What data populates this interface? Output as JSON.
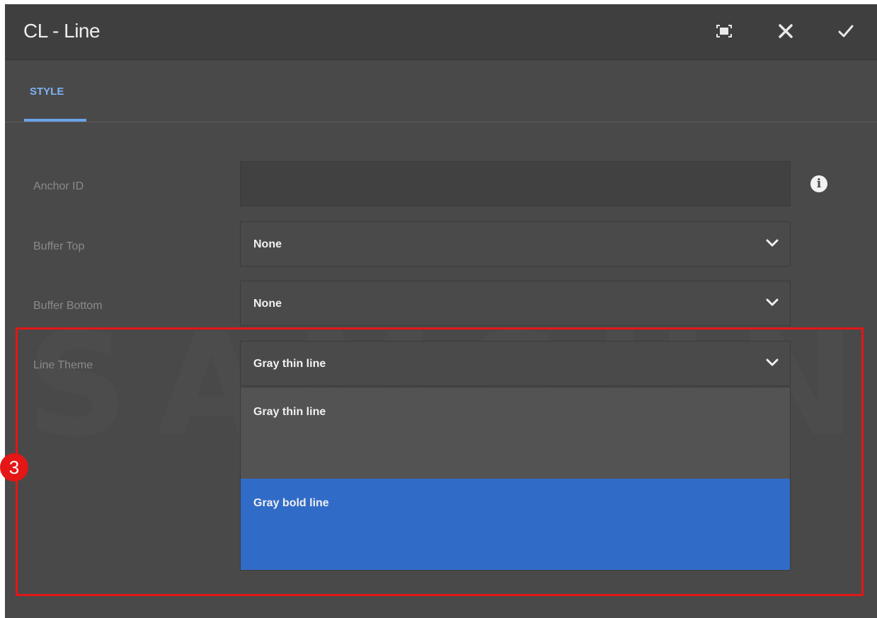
{
  "dialog": {
    "title": "CL - Line",
    "buttons": {
      "fullscreen_icon": "fullscreen-icon",
      "close_icon": "close-icon",
      "confirm_icon": "check-icon"
    }
  },
  "tabs": [
    {
      "label": "STYLE",
      "active": true
    }
  ],
  "watermark": "SAMSUNG",
  "form": {
    "anchor_id": {
      "label": "Anchor ID",
      "value": ""
    },
    "buffer_top": {
      "label": "Buffer Top",
      "value": "None"
    },
    "buffer_bottom": {
      "label": "Buffer Bottom",
      "value": "None"
    },
    "line_theme": {
      "label": "Line Theme",
      "value": "Gray thin line",
      "options": [
        {
          "label": "Gray thin line",
          "selected": false
        },
        {
          "label": "Gray bold line",
          "selected": true
        }
      ]
    }
  },
  "annotation": {
    "step": "3",
    "color": "#e41616"
  },
  "colors": {
    "accent": "#6aa3e8",
    "selected_option": "#316bc8",
    "dialog_bg": "#494949",
    "titlebar_bg": "#3f3f3f"
  }
}
